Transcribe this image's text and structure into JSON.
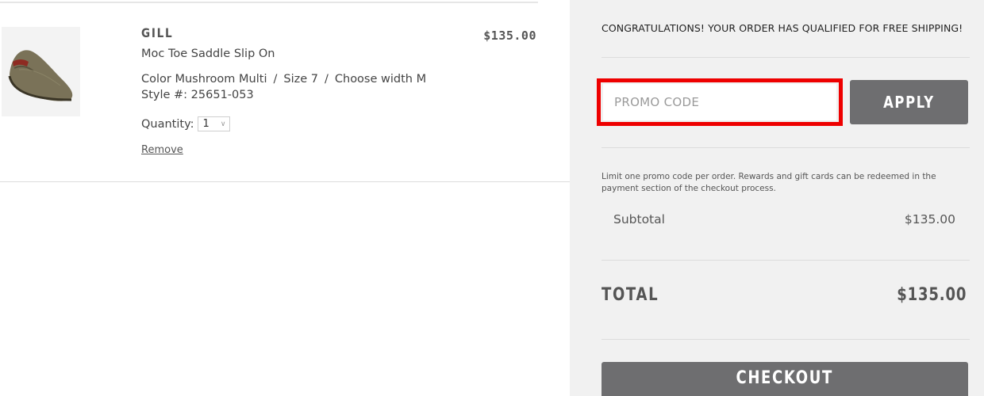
{
  "cart_item": {
    "brand": "GILL",
    "name": "Moc Toe Saddle Slip On",
    "color": "Color Mushroom Multi",
    "size": "Size 7",
    "width": "Choose width M",
    "separator": "/",
    "style": "Style #: 25651-053",
    "quantity_label": "Quantity:",
    "quantity_value": "1",
    "remove_label": "Remove",
    "price": "$135.00",
    "image_icon": "shoe-thumbnail"
  },
  "summary": {
    "free_shipping_message": "CONGRATULATIONS! YOUR ORDER HAS QUALIFIED FOR FREE SHIPPING!",
    "promo_placeholder": "PROMO CODE",
    "apply_label": "APPLY",
    "promo_note": "Limit one promo code per order. Rewards and gift cards can be redeemed in the payment section of the checkout process.",
    "subtotal_label": "Subtotal",
    "subtotal_value": "$135.00",
    "total_label": "TOTAL",
    "total_value": "$135.00",
    "checkout_label": "CHECKOUT"
  },
  "colors": {
    "highlight": "#ee0000",
    "button_bg": "#6e6e70",
    "panel_bg": "#f1f1f1"
  }
}
